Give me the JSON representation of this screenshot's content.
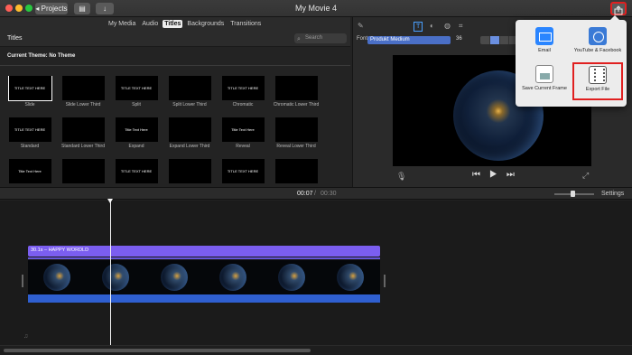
{
  "window": {
    "title": "My Movie 4"
  },
  "toolbar": {
    "projects_label": "◂ Projects"
  },
  "browser": {
    "tabs": [
      {
        "label": "My Media",
        "active": false
      },
      {
        "label": "Audio",
        "active": false
      },
      {
        "label": "Titles",
        "active": true
      },
      {
        "label": "Backgrounds",
        "active": false
      },
      {
        "label": "Transitions",
        "active": false
      }
    ],
    "heading": "Titles",
    "search_placeholder": "Search",
    "current_theme": "Current Theme: No Theme",
    "titles": [
      {
        "label": "Slide",
        "thumb_text": "TITLE TEXT HERE",
        "selected": true
      },
      {
        "label": "Slide Lower Third",
        "thumb_text": ""
      },
      {
        "label": "Split",
        "thumb_text": "TITLE TEXT HERE"
      },
      {
        "label": "Split Lower Third",
        "thumb_text": ""
      },
      {
        "label": "Chromatic",
        "thumb_text": "TITLE TEXT HERE"
      },
      {
        "label": "Chromatic Lower Third",
        "thumb_text": ""
      },
      {
        "label": "Standard",
        "thumb_text": "TITLE TEXT HERE"
      },
      {
        "label": "Standard Lower Third",
        "thumb_text": ""
      },
      {
        "label": "Expand",
        "thumb_text": "Title Text Here"
      },
      {
        "label": "Expand Lower Third",
        "thumb_text": ""
      },
      {
        "label": "Reveal",
        "thumb_text": "Title Text Here"
      },
      {
        "label": "Reveal Lower Third",
        "thumb_text": ""
      },
      {
        "label": "",
        "thumb_text": "Title Text Here"
      },
      {
        "label": "",
        "thumb_text": ""
      },
      {
        "label": "",
        "thumb_text": "TITLE TEXT HERE"
      },
      {
        "label": "",
        "thumb_text": ""
      },
      {
        "label": "",
        "thumb_text": "TITLE TEXT HERE"
      },
      {
        "label": "",
        "thumb_text": ""
      }
    ]
  },
  "viewer": {
    "font_label": "Font:",
    "font_value": "Produkt Medium",
    "font_size": "36"
  },
  "share_menu": {
    "email": "Email",
    "youtube": "YouTube & Facebook",
    "save_frame": "Save Current Frame",
    "export_file": "Export File"
  },
  "timeline": {
    "current_time": "00:07",
    "separator": "/",
    "total_time": "00:30",
    "settings_label": "Settings",
    "title_clip_label": "30.1s – HAPPY WORDLD"
  }
}
